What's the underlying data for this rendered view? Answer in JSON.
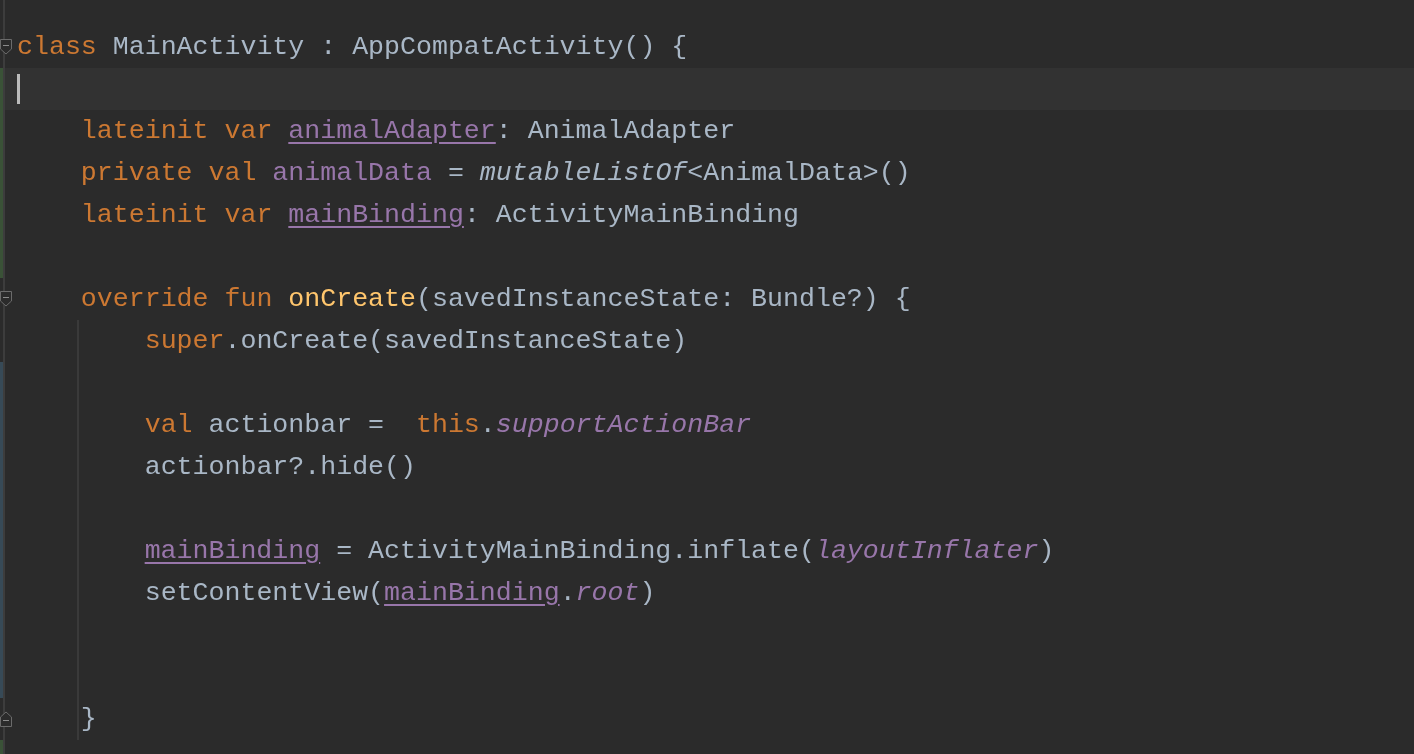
{
  "editor": {
    "lines": [
      {
        "fold_start": true,
        "tokens": [
          {
            "kind": "keyword",
            "text": "class "
          },
          {
            "kind": "plain",
            "text": "MainActivity : AppCompatActivity() {"
          }
        ]
      },
      {
        "current": true,
        "added": true
      },
      {
        "added": true,
        "tokens": [
          {
            "kind": "keyword",
            "text": "    lateinit var "
          },
          {
            "kind": "property-underlined",
            "text": "animalAdapter"
          },
          {
            "kind": "plain",
            "text": ": AnimalAdapter"
          }
        ]
      },
      {
        "added": true,
        "tokens": [
          {
            "kind": "keyword",
            "text": "    private val "
          },
          {
            "kind": "property",
            "text": "animalData"
          },
          {
            "kind": "plain",
            "text": " = "
          },
          {
            "kind": "call-italic",
            "text": "mutableListOf"
          },
          {
            "kind": "plain",
            "text": "<AnimalData>()"
          }
        ]
      },
      {
        "added": true,
        "tokens": [
          {
            "kind": "keyword",
            "text": "    lateinit var "
          },
          {
            "kind": "property-underlined",
            "text": "mainBinding"
          },
          {
            "kind": "plain",
            "text": ": ActivityMainBinding"
          }
        ]
      },
      {
        "added": true
      },
      {
        "fold_start": true,
        "tokens": [
          {
            "kind": "keyword",
            "text": "    override fun "
          },
          {
            "kind": "function",
            "text": "onCreate"
          },
          {
            "kind": "plain",
            "text": "(savedInstanceState: Bundle?) {"
          }
        ]
      },
      {
        "tokens": [
          {
            "kind": "keyword",
            "text": "        super"
          },
          {
            "kind": "plain",
            "text": ".onCreate(savedInstanceState)"
          }
        ]
      },
      {
        "modified": true
      },
      {
        "modified": true,
        "tokens": [
          {
            "kind": "keyword",
            "text": "        val "
          },
          {
            "kind": "plain",
            "text": "actionbar =  "
          },
          {
            "kind": "keyword",
            "text": "this"
          },
          {
            "kind": "plain",
            "text": "."
          },
          {
            "kind": "property-italic",
            "text": "supportActionBar"
          }
        ]
      },
      {
        "modified": true,
        "tokens": [
          {
            "kind": "plain",
            "text": "        actionbar?.hide()"
          }
        ]
      },
      {
        "modified": true
      },
      {
        "modified": true,
        "tokens": [
          {
            "kind": "property-underlined",
            "text": "mainBinding",
            "indented": true
          },
          {
            "kind": "plain",
            "text": " = ActivityMainBinding.inflate("
          },
          {
            "kind": "property-italic",
            "text": "layoutInflater"
          },
          {
            "kind": "plain",
            "text": ")"
          }
        ]
      },
      {
        "modified": true,
        "tokens": [
          {
            "kind": "plain",
            "text": "        setContentView("
          },
          {
            "kind": "property-underlined",
            "text": "mainBinding"
          },
          {
            "kind": "plain",
            "text": "."
          },
          {
            "kind": "property-italic",
            "text": "root"
          },
          {
            "kind": "plain",
            "text": ")"
          }
        ]
      },
      {
        "modified": true
      },
      {
        "modified": true
      },
      {
        "fold_end": true,
        "tokens": [
          {
            "kind": "plain",
            "text": "    }"
          }
        ]
      },
      {
        "added": true
      }
    ]
  }
}
